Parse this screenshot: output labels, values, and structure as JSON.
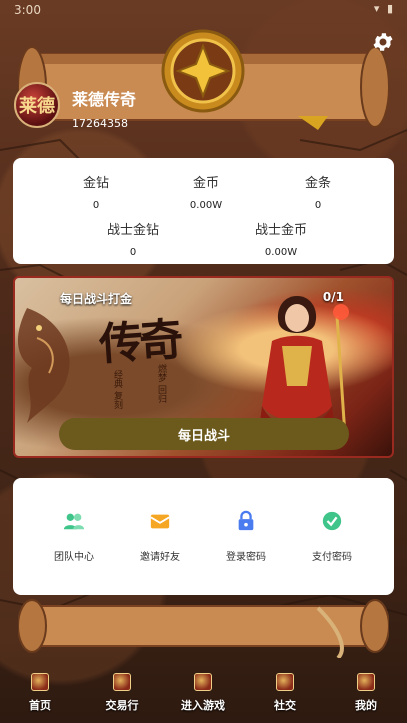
{
  "status_bar": {
    "time": "3:00",
    "icons": "▾ ▮"
  },
  "profile": {
    "avatar_text": "莱德",
    "name": "莱德传奇",
    "id": "17264358"
  },
  "assets": [
    {
      "label": "金钻",
      "value": "0"
    },
    {
      "label": "金币",
      "value": "0.00W"
    },
    {
      "label": "金条",
      "value": "0"
    },
    {
      "label": "战士金钻",
      "value": "0"
    },
    {
      "label": "战士金币",
      "value": "0.00W"
    }
  ],
  "banner": {
    "title": "每日战斗打金",
    "progress": "0/1",
    "art_title": "传奇",
    "art_sub_1": "经典 复刻",
    "art_sub_2": "燃梦 回归",
    "button": "每日战斗"
  },
  "actions": [
    {
      "label": "团队中心",
      "icon": "team-icon",
      "color": "#3fc48a"
    },
    {
      "label": "邀请好友",
      "icon": "envelope-icon",
      "color": "#f5a623"
    },
    {
      "label": "登录密码",
      "icon": "lock-icon",
      "color": "#4a7cf0"
    },
    {
      "label": "支付密码",
      "icon": "check-shield-icon",
      "color": "#3fc48a"
    }
  ],
  "tabs": [
    {
      "label": "首页"
    },
    {
      "label": "交易行"
    },
    {
      "label": "进入游戏"
    },
    {
      "label": "社交"
    },
    {
      "label": "我的"
    }
  ],
  "colors": {
    "button_bg": "#6b5a1c",
    "card_bg": "#ffffff",
    "accent_red": "#9a2a20"
  }
}
